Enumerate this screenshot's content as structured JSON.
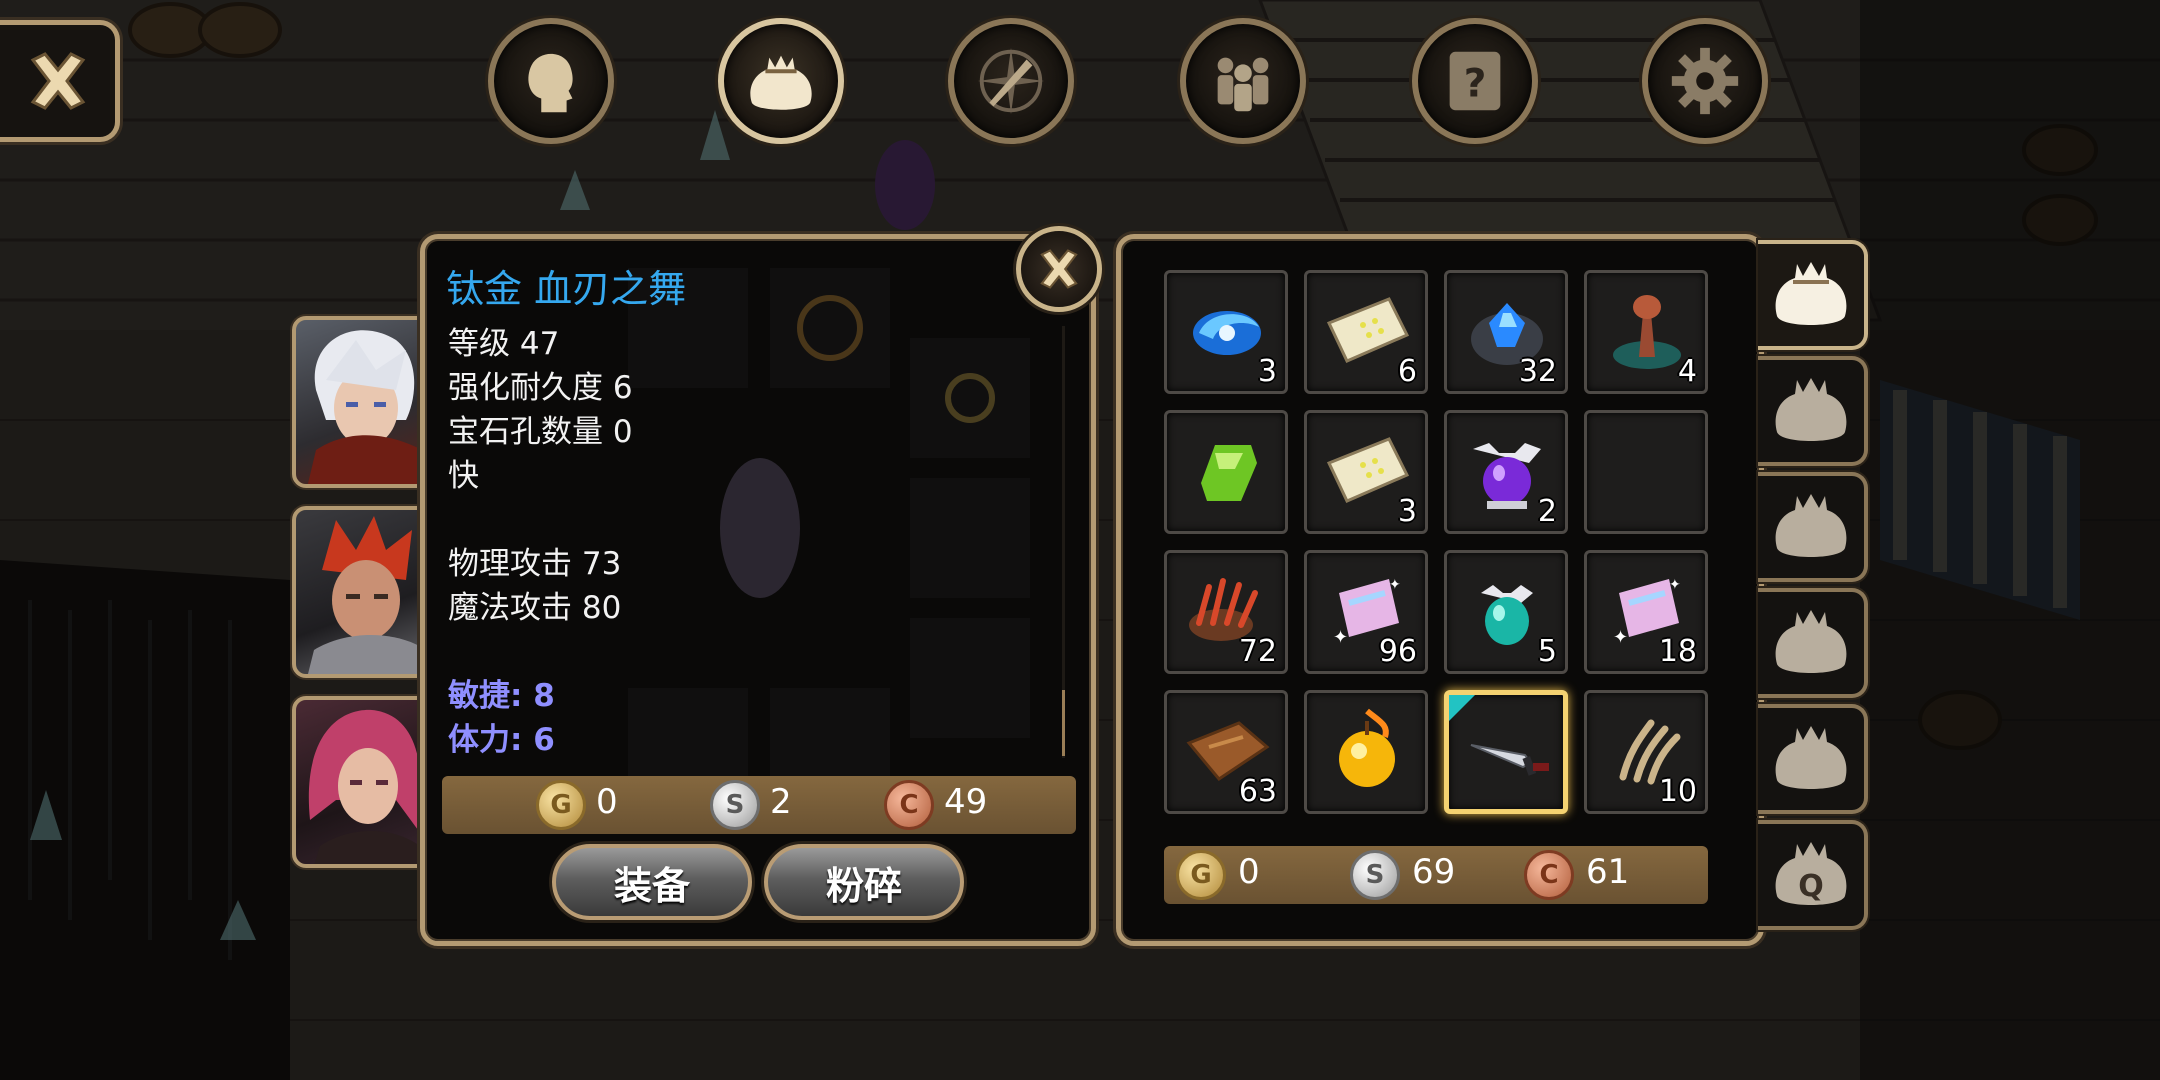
{
  "nav": {
    "tabs": [
      {
        "id": "character",
        "icon": "head-icon",
        "active": false
      },
      {
        "id": "bag",
        "icon": "bag-icon",
        "active": true
      },
      {
        "id": "skills",
        "icon": "sword-compass-icon",
        "active": false
      },
      {
        "id": "party",
        "icon": "party-icon",
        "active": false
      },
      {
        "id": "quests",
        "icon": "quest-scroll-icon",
        "active": false
      },
      {
        "id": "settings",
        "icon": "gear-icon",
        "active": false
      }
    ]
  },
  "item_detail": {
    "name": "钛金 血刃之舞",
    "name_color": "#35a8ef",
    "stats": [
      "等级 47",
      "强化耐久度 6",
      "宝石孔数量 0",
      "快",
      "",
      "物理攻击 73",
      "魔法攻击 80",
      ""
    ],
    "bonus_stats": [
      "敏捷: 8",
      "体力: 6"
    ],
    "bonus_color": "#8f8fff",
    "currency": {
      "gold": "0",
      "silver": "2",
      "copper": "49"
    },
    "buttons": {
      "equip": "装备",
      "shatter": "粉碎"
    }
  },
  "inventory": {
    "slots": [
      {
        "icon": "blue-swirl-gem-icon",
        "qty": "3"
      },
      {
        "icon": "yellow-scroll-icon",
        "qty": "6"
      },
      {
        "icon": "blue-crystal-ore-icon",
        "qty": "32"
      },
      {
        "icon": "mushroom-creature-icon",
        "qty": "4"
      },
      {
        "icon": "green-gem-icon",
        "qty": ""
      },
      {
        "icon": "yellow-scroll-icon",
        "qty": "3"
      },
      {
        "icon": "purple-potion-icon",
        "qty": "2"
      },
      {
        "icon": "empty-slot",
        "qty": ""
      },
      {
        "icon": "red-claw-icon",
        "qty": "72"
      },
      {
        "icon": "sparkle-ticket-icon",
        "qty": "96"
      },
      {
        "icon": "teal-potion-icon",
        "qty": "5"
      },
      {
        "icon": "sparkle-ticket-icon",
        "qty": "18"
      },
      {
        "icon": "leather-hide-icon",
        "qty": "63"
      },
      {
        "icon": "golden-apple-icon",
        "qty": ""
      },
      {
        "icon": "dagger-icon",
        "qty": "",
        "selected": true
      },
      {
        "icon": "beast-claw-icon",
        "qty": "10"
      }
    ],
    "currency": {
      "gold": "0",
      "silver": "69",
      "copper": "61"
    }
  },
  "bag_tabs": [
    {
      "icon": "bag-icon",
      "active": true
    },
    {
      "icon": "bag-icon",
      "active": false
    },
    {
      "icon": "bag-icon",
      "active": false
    },
    {
      "icon": "bag-icon",
      "active": false
    },
    {
      "icon": "bag-icon",
      "active": false
    },
    {
      "icon": "quest-bag-icon",
      "label": "Q",
      "active": false
    }
  ],
  "coin_letters": {
    "gold": "G",
    "silver": "S",
    "copper": "C"
  },
  "party": [
    {
      "icon": "white-haired-hero-portrait"
    },
    {
      "icon": "red-haired-warrior-portrait"
    },
    {
      "icon": "pink-haired-mage-portrait"
    }
  ]
}
